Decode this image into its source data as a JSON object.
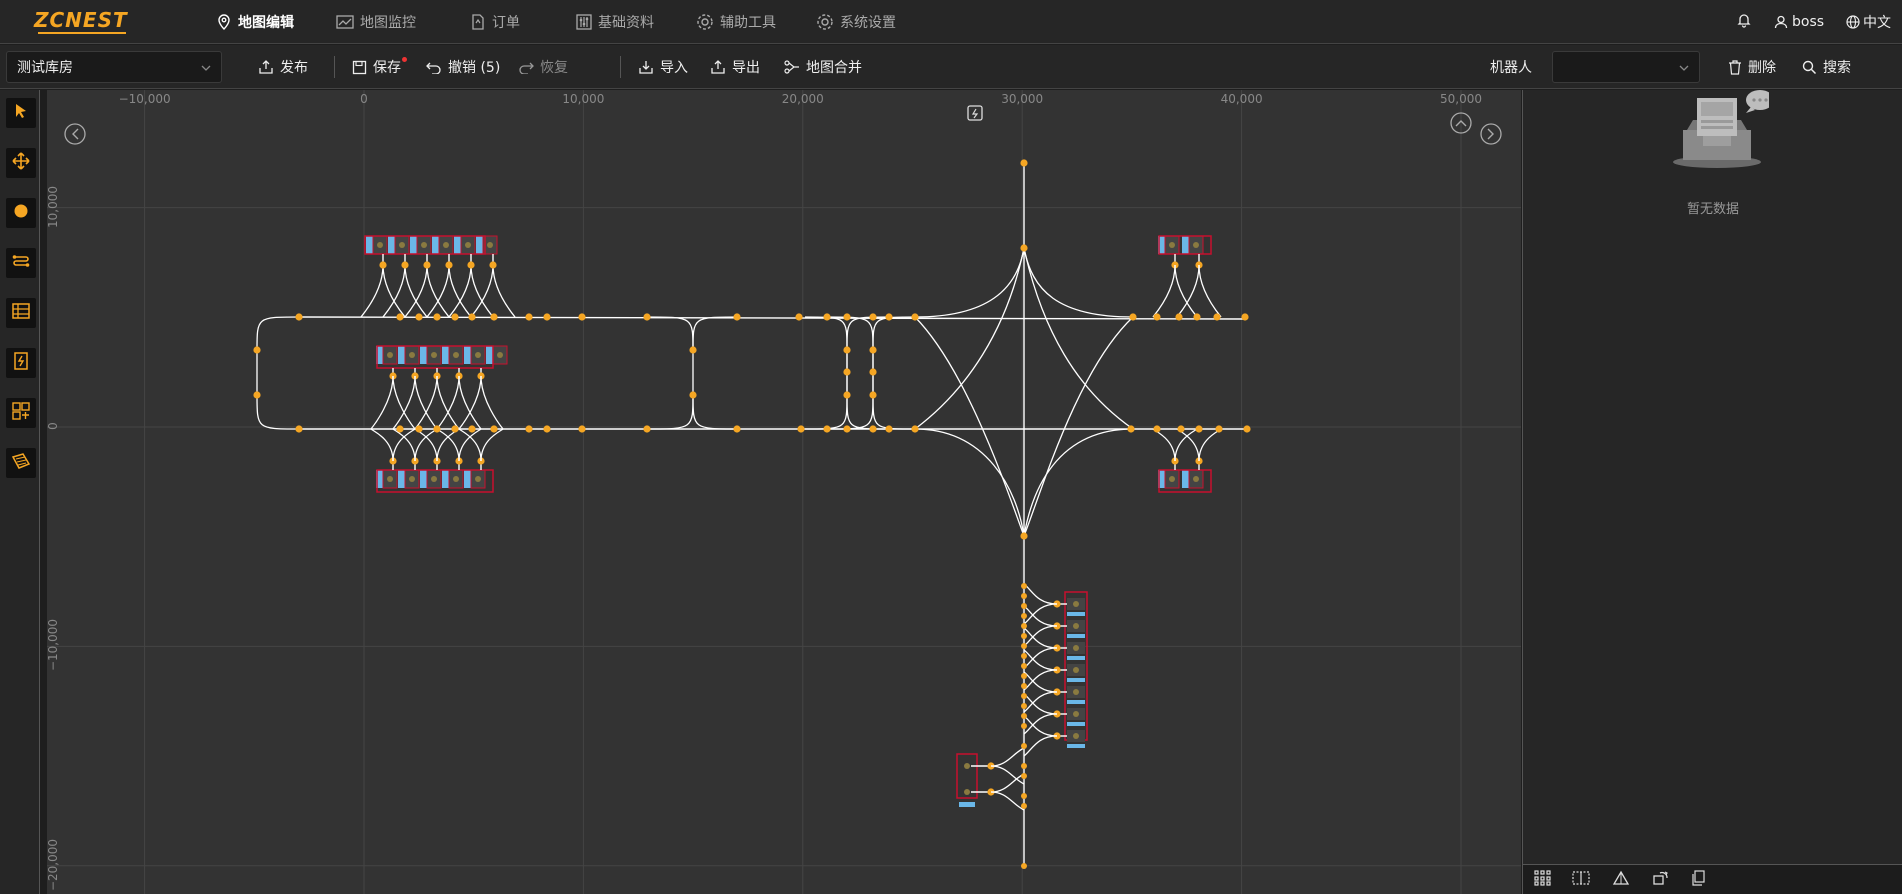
{
  "header": {
    "logo": "ZCNEST",
    "nav": [
      {
        "label": "地图编辑",
        "icon": "location-pin-icon",
        "active": true
      },
      {
        "label": "地图监控",
        "icon": "chart-icon",
        "active": false
      },
      {
        "label": "订单",
        "icon": "document-icon",
        "active": false
      },
      {
        "label": "基础资料",
        "icon": "sliders-icon",
        "active": false
      },
      {
        "label": "辅助工具",
        "icon": "gear-icon",
        "active": false
      },
      {
        "label": "系统设置",
        "icon": "gear-icon",
        "active": false
      }
    ],
    "user": "boss",
    "language": "中文"
  },
  "toolbar": {
    "map_select": "测试库房",
    "publish": "发布",
    "save": "保存",
    "undo": "撤销 (5)",
    "redo": "恢复",
    "import": "导入",
    "export": "导出",
    "merge": "地图合并",
    "robot_label": "机器人",
    "robot_select": "",
    "delete": "删除",
    "search": "搜索"
  },
  "sidebar_tools": [
    "select-arrow-icon",
    "move-icon",
    "point-icon",
    "path-icon",
    "shelf-icon",
    "charger-icon",
    "area-icon",
    "polygon-icon"
  ],
  "canvas": {
    "x_ticks": [
      "−10,000",
      "0",
      "10,000",
      "20,000",
      "30,000",
      "40,000",
      "50,000"
    ],
    "y_ticks": [
      "10,000",
      "0",
      "−10,000",
      "−20,000"
    ],
    "colors": {
      "node": "#f5a623",
      "path": "#ffffff",
      "station_border": "#c8102e",
      "station_fill": "#6ab7e8",
      "grid": "#454545"
    }
  },
  "right_panel": {
    "empty_text": "暂无数据"
  }
}
